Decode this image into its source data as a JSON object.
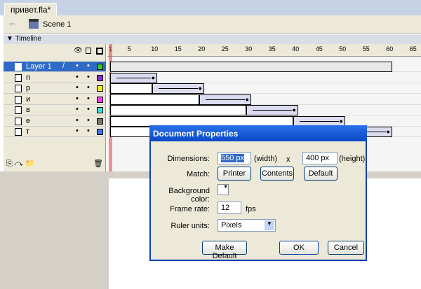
{
  "document_tab": "привет.fla*",
  "scene": "Scene 1",
  "timeline": {
    "title": "Timeline",
    "ruler_ticks": [
      "1",
      "5",
      "10",
      "15",
      "20",
      "25",
      "30",
      "35",
      "40",
      "45",
      "50",
      "55",
      "60",
      "65"
    ],
    "layers": [
      {
        "name": "Layer 1",
        "color": "#33cc33",
        "selected": true
      },
      {
        "name": "п",
        "color": "#8833cc"
      },
      {
        "name": "р",
        "color": "#eeee22"
      },
      {
        "name": "и",
        "color": "#ee44ee"
      },
      {
        "name": "в",
        "color": "#44dddd"
      },
      {
        "name": "е",
        "color": "#777777"
      },
      {
        "name": "т",
        "color": "#4477ee"
      }
    ],
    "tweens": [
      [
        1,
        60
      ],
      [
        1,
        10
      ],
      [
        10,
        20
      ],
      [
        20,
        30
      ],
      [
        30,
        40
      ],
      [
        40,
        50
      ],
      [
        50,
        60
      ]
    ],
    "current_frame": 1
  },
  "dialog": {
    "title": "Document Properties",
    "dimensions_label": "Dimensions:",
    "width": "550 px",
    "width_label": "(width)",
    "x": "x",
    "height": "400 px",
    "height_label": "(height)",
    "match_label": "Match:",
    "printer": "Printer",
    "contents": "Contents",
    "default": "Default",
    "bg_label": "Background color:",
    "bg_color": "#ffffff",
    "fps_label": "Frame rate:",
    "fps": "12",
    "fps_unit": "fps",
    "ruler_label": "Ruler units:",
    "ruler_value": "Pixels",
    "make_default": "Make Default",
    "ok": "OK",
    "cancel": "Cancel"
  }
}
